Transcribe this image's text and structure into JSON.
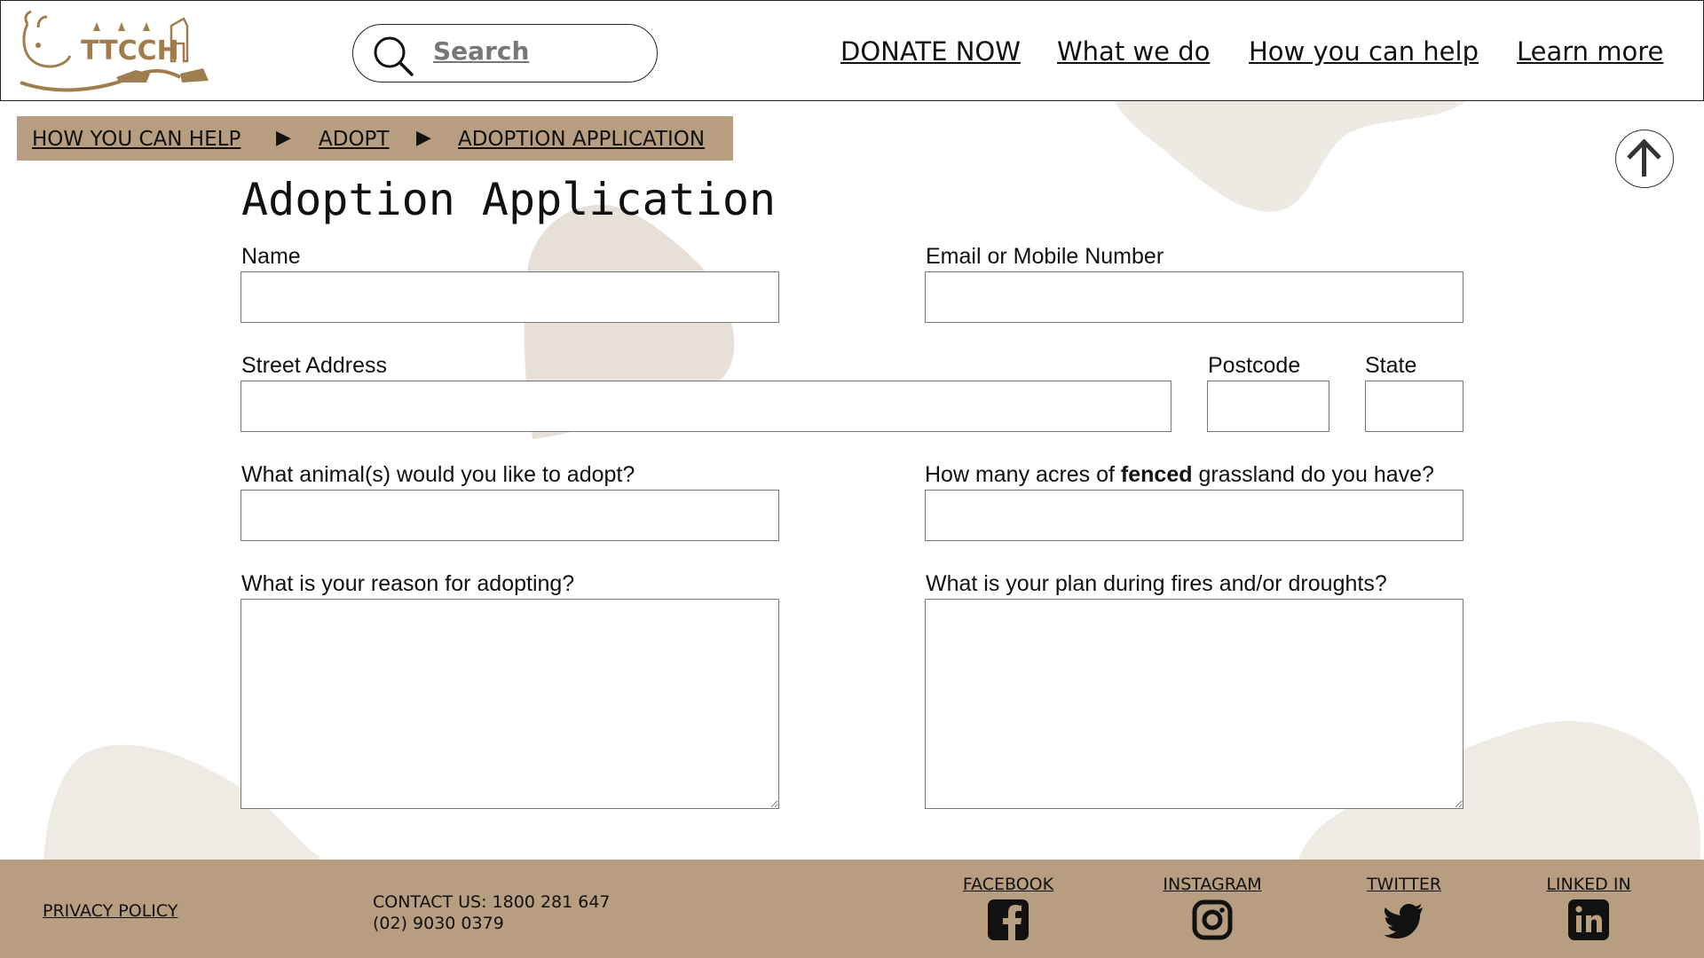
{
  "header": {
    "logo_text": "TTCCH",
    "search": {
      "label": "Search",
      "icon": "search-icon"
    },
    "nav": [
      {
        "label": "DONATE NOW"
      },
      {
        "label": "What we do"
      },
      {
        "label": "How you can help"
      },
      {
        "label": "Learn more"
      }
    ]
  },
  "breadcrumb": [
    {
      "label": "HOW YOU CAN HELP"
    },
    {
      "label": "ADOPT"
    },
    {
      "label": "ADOPTION APPLICATION"
    }
  ],
  "scroll_top_icon": "arrow-up-icon",
  "page_title": "Adoption Application",
  "form": {
    "name_label": "Name",
    "contact_label": "Email or Mobile Number",
    "street_label": "Street Address",
    "postcode_label": "Postcode",
    "state_label": "State",
    "animal_label": "What animal(s) would you like to adopt?",
    "acres_label_pre": "How many acres of ",
    "acres_label_bold": "fenced",
    "acres_label_post": " grassland do you have?",
    "reason_label": "What is your reason for adopting?",
    "plan_label": "What is your plan during fires and/or droughts?",
    "values": {
      "name": "",
      "contact": "",
      "street": "",
      "postcode": "",
      "state": "",
      "animal": "",
      "acres": "",
      "reason": "",
      "plan": ""
    }
  },
  "footer": {
    "privacy": "PRIVACY POLICY",
    "contact_line1": "CONTACT US: 1800 281 647",
    "contact_line2": "(02) 9030 0379",
    "social": [
      {
        "label": "FACEBOOK",
        "icon": "facebook-icon"
      },
      {
        "label": "INSTAGRAM",
        "icon": "instagram-icon"
      },
      {
        "label": "TWITTER",
        "icon": "twitter-icon"
      },
      {
        "label": "LINKED IN",
        "icon": "linkedin-icon"
      }
    ]
  },
  "colors": {
    "brand_tan": "#b89e80",
    "logo_brown": "#a07d4e",
    "blob": "#e8e3dc"
  }
}
